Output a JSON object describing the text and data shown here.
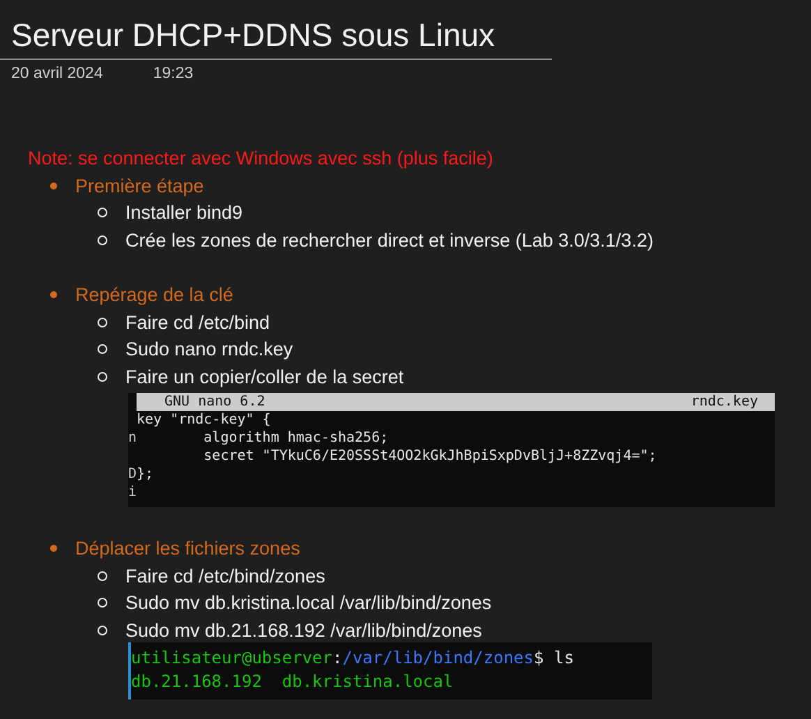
{
  "title": "Serveur DHCP+DDNS sous Linux",
  "date": "20 avril 2024",
  "time": "19:23",
  "note": "Note: se connecter avec Windows avec ssh (plus facile)",
  "sections": [
    {
      "heading": "Première étape",
      "items": [
        "Installer bind9",
        "Crée les zones de rechercher direct et inverse (Lab 3.0/3.1/3.2)"
      ]
    },
    {
      "heading": "Repérage de la clé",
      "items": [
        "Faire cd /etc/bind",
        "Sudo nano rndc.key",
        "Faire un copier/coller de la secret"
      ],
      "screenshot": {
        "kind": "nano",
        "header_left": "GNU nano 6.2",
        "header_right": "rndc.key",
        "lines": [
          {
            "code": "key \"rndc-key\" {"
          },
          {
            "margin": "n",
            "code": "        algorithm hmac-sha256;"
          },
          {
            "code": "        secret \"TYkuC6/E20SSSt4OO2kGkJhBpiSxpDvBljJ+8ZZvqj4=\";"
          },
          {
            "margin": "D",
            "code": "};"
          },
          {
            "margin": "i"
          }
        ]
      }
    },
    {
      "heading": "Déplacer les fichiers zones",
      "items": [
        "Faire cd /etc/bind/zones",
        "Sudo mv db.kristina.local /var/lib/bind/zones",
        "Sudo mv db.21.168.192 /var/lib/bind/zones"
      ],
      "screenshot": {
        "kind": "terminal",
        "lines": [
          [
            {
              "kind": "user",
              "text": "utilisateur@ubserver"
            },
            {
              "kind": "plain",
              "text": ":"
            },
            {
              "kind": "path",
              "text": "/var/lib/bind/zones"
            },
            {
              "kind": "plain",
              "text": "$ ls"
            }
          ],
          [
            {
              "kind": "user",
              "text": "db.21.168.192  db.kristina.local"
            }
          ]
        ]
      }
    }
  ]
}
